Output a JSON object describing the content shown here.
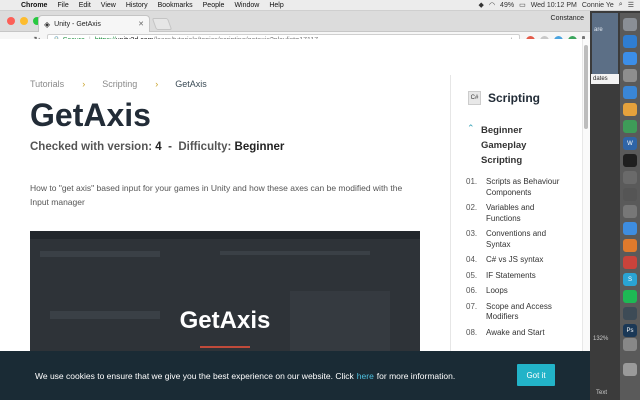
{
  "menubar": {
    "app": "Chrome",
    "items": [
      "File",
      "Edit",
      "View",
      "History",
      "Bookmarks",
      "People",
      "Window",
      "Help"
    ],
    "battery": "49%",
    "clock": "Wed 10:12 PM",
    "user": "Connie Ye"
  },
  "browser": {
    "tab_title": "Unity - GetAxis",
    "profile_name": "Constance",
    "secure_label": "Secure",
    "url_scheme": "https://",
    "url_host": "unity3d.com",
    "url_path": "/learn/tutorials/topics/scripting/getaxis?playlist=17117"
  },
  "page": {
    "breadcrumb": [
      "Tutorials",
      "Scripting",
      "GetAxis"
    ],
    "title": "GetAxis",
    "version_label": "Checked with version:",
    "version_value": "4",
    "difficulty_label": "Difficulty:",
    "difficulty_value": "Beginner",
    "description": "How to \"get axis\" based input for your games in Unity and how these axes can be modified with the Input manager",
    "video_title": "GetAxis"
  },
  "sidebar": {
    "icon_text": "C#",
    "title": "Scripting",
    "section": "Beginner Gameplay Scripting",
    "items": [
      {
        "num": "01.",
        "label": "Scripts as Behaviour Components"
      },
      {
        "num": "02.",
        "label": "Variables and Functions"
      },
      {
        "num": "03.",
        "label": "Conventions and Syntax"
      },
      {
        "num": "04.",
        "label": "C# vs JS syntax"
      },
      {
        "num": "05.",
        "label": "IF Statements"
      },
      {
        "num": "06.",
        "label": "Loops"
      },
      {
        "num": "07.",
        "label": "Scope and Access Modifiers"
      },
      {
        "num": "08.",
        "label": "Awake and Start"
      }
    ]
  },
  "cookie": {
    "text_before": "We use cookies to ensure that we give you the best experience on our website. Click",
    "link": "here",
    "text_after": "for more information.",
    "button": "Got it"
  },
  "desktop": {
    "notif_text": "are",
    "updates": "dates",
    "zoom": "132%",
    "text_label": "Text"
  },
  "colors": {
    "accent": "#22b3c8",
    "banner_bg": "#1a2b35",
    "title": "#222c37",
    "breadcrumb_chevron": "#c9a227"
  }
}
